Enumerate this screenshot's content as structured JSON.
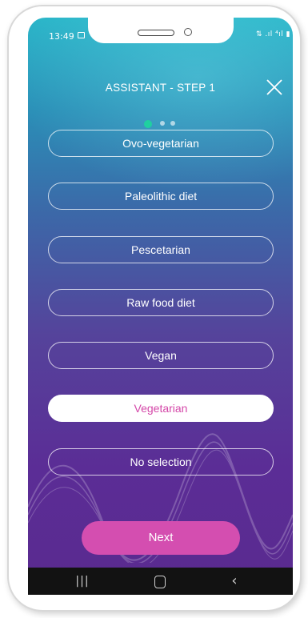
{
  "status_bar": {
    "time": "13:49",
    "image_icon": "image-icon",
    "right_icons": "⇅ .ıl ⁴ıl ▮"
  },
  "header": {
    "title": "ASSISTANT - STEP 1",
    "close_icon": "close-icon"
  },
  "stepper": {
    "total": 3,
    "current": 1,
    "active_color": "#1fd0a0"
  },
  "options": [
    {
      "label": "Ovo-vegetarian",
      "selected": false
    },
    {
      "label": "Paleolithic diet",
      "selected": false
    },
    {
      "label": "Pescetarian",
      "selected": false
    },
    {
      "label": "Raw food diet",
      "selected": false
    },
    {
      "label": "Vegan",
      "selected": false
    },
    {
      "label": "Vegetarian",
      "selected": true
    },
    {
      "label": "No selection",
      "selected": false
    }
  ],
  "next_button": {
    "label": "Next",
    "color": "#d44eb0"
  },
  "nav_bar": {
    "recent_label": "|||",
    "home_icon": "home-icon",
    "back_label": "‹"
  },
  "colors": {
    "selected_text": "#d447a8",
    "gradient_top": "#2bb6c9",
    "gradient_bottom": "#5a2a8f"
  }
}
